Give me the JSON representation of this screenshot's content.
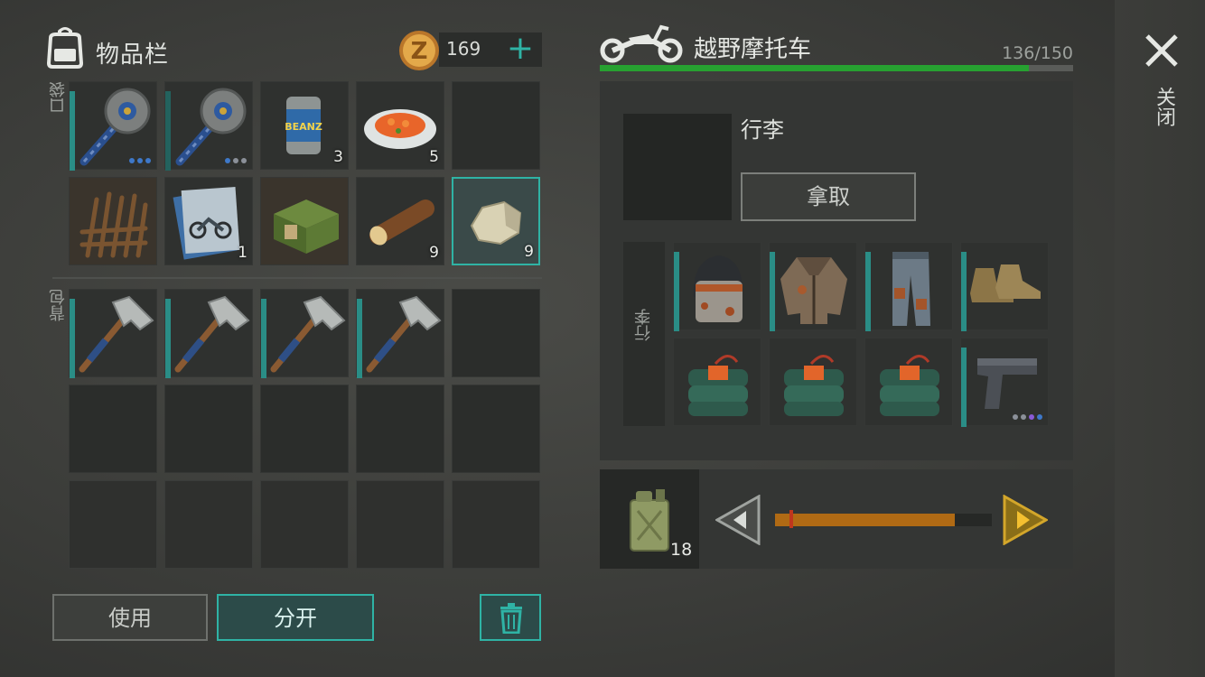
{
  "inventory": {
    "title": "物品栏",
    "coins": "169",
    "pocket_label": "口袋",
    "backpack_label": "背包",
    "pocket_slots": [
      {
        "item": "circular-saw-mace",
        "qty": "",
        "dots": 3
      },
      {
        "item": "circular-saw-mace",
        "qty": "",
        "dots": 3
      },
      {
        "item": "canned-beans",
        "qty": "3"
      },
      {
        "item": "carrot-plate",
        "qty": "5"
      },
      {
        "item": "empty",
        "qty": ""
      },
      {
        "item": "wooden-spikes",
        "qty": ""
      },
      {
        "item": "motorcycle-blueprint",
        "qty": "1"
      },
      {
        "item": "green-crate",
        "qty": ""
      },
      {
        "item": "log",
        "qty": "9"
      },
      {
        "item": "stone",
        "qty": "9",
        "selected": true
      }
    ],
    "backpack_slots": [
      {
        "item": "hammer",
        "qty": ""
      },
      {
        "item": "hammer",
        "qty": ""
      },
      {
        "item": "hammer",
        "qty": ""
      },
      {
        "item": "hammer",
        "qty": ""
      }
    ],
    "buttons": {
      "use": "使用",
      "split": "分开"
    }
  },
  "vehicle": {
    "title": "越野摩托车",
    "capacity": "136/150",
    "capacity_fraction": 0.9067,
    "storage": {
      "name": "行李",
      "take_button": "拿取",
      "trunk_label": "行李",
      "items": [
        {
          "item": "helmet"
        },
        {
          "item": "jacket"
        },
        {
          "item": "pants"
        },
        {
          "item": "boots"
        },
        {
          "item": "c4"
        },
        {
          "item": "c4"
        },
        {
          "item": "c4"
        },
        {
          "item": "pistol",
          "dots": 4
        }
      ]
    },
    "fuel": {
      "item": "jerrycan",
      "qty": "18",
      "slider_fraction": 0.83
    }
  },
  "close": {
    "label": "关闭"
  },
  "colors": {
    "accent": "#2fb3a5",
    "capacity_bar": "#27a131",
    "fuel_bar": "#b06a14"
  }
}
